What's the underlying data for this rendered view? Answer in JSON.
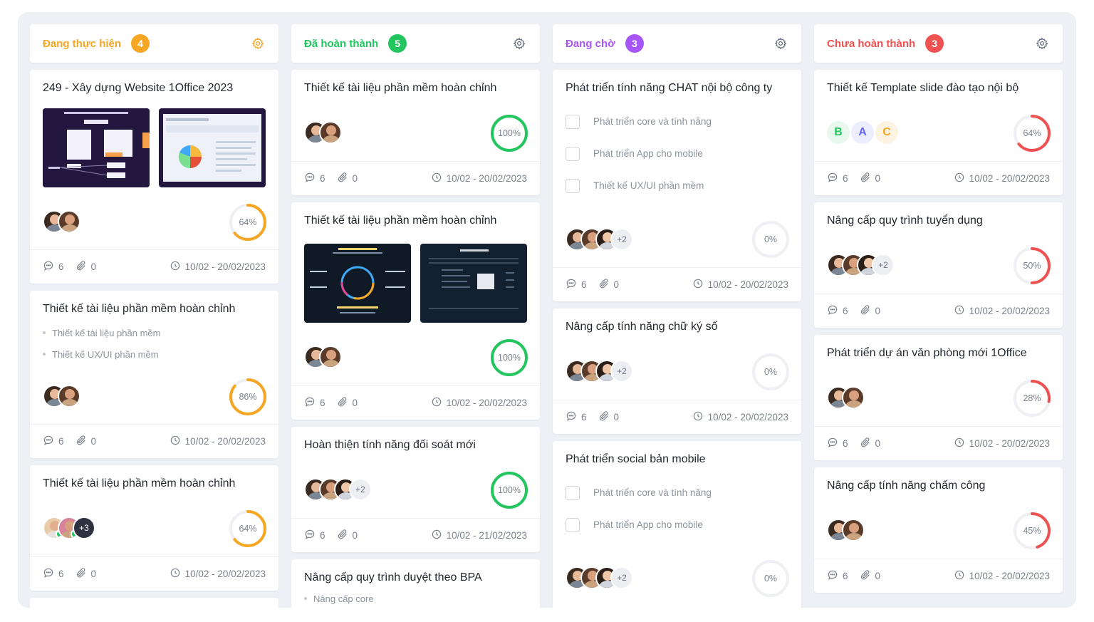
{
  "columns": [
    {
      "title": "Đang thực hiện",
      "count": "4",
      "color": "#f5a623",
      "cards": [
        {
          "title": "249 - Xây dựng Website 1Office 2023",
          "progress": 64,
          "progress_label": "64%",
          "comments": "6",
          "attachments": "0",
          "date": "10/02 - 20/02/2023"
        },
        {
          "title": "Thiết kế tài liệu phần mềm hoàn chỉnh",
          "subtasks": [
            "Thiết kế tài liệu phần mềm",
            "Thiết kế UX/UI phần mềm"
          ],
          "progress": 86,
          "progress_label": "86%",
          "comments": "6",
          "attachments": "0",
          "date": "10/02 - 20/02/2023"
        },
        {
          "title": "Thiết kế tài liệu phần mềm hoàn chỉnh",
          "more": "+3",
          "progress": 64,
          "progress_label": "64%",
          "comments": "6",
          "attachments": "0",
          "date": "10/02 - 20/02/2023"
        }
      ]
    },
    {
      "title": "Đã hoàn thành",
      "count": "5",
      "color": "#22c55e",
      "cards": [
        {
          "title": "Thiết kế tài liệu phần mềm hoàn chỉnh",
          "progress": 100,
          "progress_label": "100%",
          "comments": "6",
          "attachments": "0",
          "date": "10/02 - 20/02/2023"
        },
        {
          "title": "Thiết kế tài liệu phần mềm hoàn chỉnh",
          "progress": 100,
          "progress_label": "100%",
          "comments": "6",
          "attachments": "0",
          "date": "10/02 - 20/02/2023"
        },
        {
          "title": "Hoàn thiện tính năng đối soát mới",
          "more": "+2",
          "progress": 100,
          "progress_label": "100%",
          "comments": "6",
          "attachments": "0",
          "date": "10/02 - 21/02/2023"
        },
        {
          "title": "Nâng cấp quy trình duyệt theo BPA",
          "subtasks": [
            "Nâng cấp core"
          ]
        }
      ]
    },
    {
      "title": "Đang chờ",
      "count": "3",
      "color": "#a855f7",
      "cards": [
        {
          "title": "Phát triển tính năng CHAT nội bộ công ty",
          "checklist": [
            "Phát triển core và tính năng",
            "Phát triển App cho mobile",
            "Thiết kế UX/UI phần mềm"
          ],
          "more": "+2",
          "progress": 0,
          "progress_label": "0%",
          "comments": "6",
          "attachments": "0",
          "date": "10/02 - 20/02/2023"
        },
        {
          "title": "Nâng cấp tính năng chữ ký số",
          "more": "+2",
          "progress": 0,
          "progress_label": "0%",
          "comments": "6",
          "attachments": "0",
          "date": "10/02 - 20/02/2023"
        },
        {
          "title": "Phát triển social bản mobile",
          "checklist": [
            "Phát triển core và tính năng",
            "Phát triển App cho mobile"
          ],
          "more": "+2",
          "progress": 0,
          "progress_label": "0%"
        }
      ]
    },
    {
      "title": "Chưa hoàn thành",
      "count": "3",
      "color": "#f05252",
      "cards": [
        {
          "title": "Thiết kế Template slide đào tạo nội bộ",
          "letters": [
            "B",
            "A",
            "C"
          ],
          "progress": 64,
          "progress_label": "64%",
          "comments": "6",
          "attachments": "0",
          "date": "10/02 - 20/02/2023"
        },
        {
          "title": "Nâng cấp quy trình tuyển dụng",
          "more": "+2",
          "progress": 50,
          "progress_label": "50%",
          "comments": "6",
          "attachments": "0",
          "date": "10/02 - 20/02/2023"
        },
        {
          "title": "Phát triển dự án văn phòng mới 1Office",
          "progress": 28,
          "progress_label": "28%",
          "comments": "6",
          "attachments": "0",
          "date": "10/02 - 20/02/2023"
        },
        {
          "title": "Nâng cấp tính năng chấm công",
          "progress": 45,
          "progress_label": "45%",
          "comments": "6",
          "attachments": "0",
          "date": "10/02 - 20/02/2023"
        }
      ]
    }
  ]
}
